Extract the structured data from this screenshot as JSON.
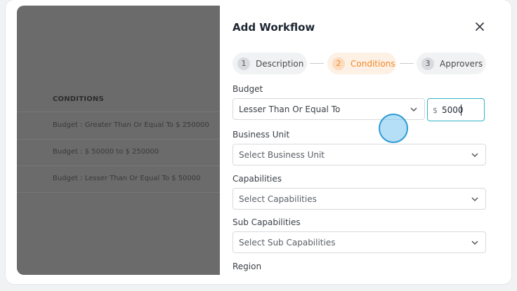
{
  "background_table": {
    "header": "CONDITIONS",
    "rows": [
      "Budget : Greater Than Or Equal To $ 250000",
      "Budget : $ 50000 to $ 250000",
      "Budget : Lesser Than Or Equal To $ 50000"
    ]
  },
  "modal": {
    "title": "Add Workflow",
    "close_icon": "close-icon",
    "steps": [
      {
        "number": "1",
        "label": "Description",
        "state": "completed"
      },
      {
        "number": "2",
        "label": "Conditions",
        "state": "active"
      },
      {
        "number": "3",
        "label": "Approvers",
        "state": "pending"
      }
    ],
    "fields": {
      "budget": {
        "label": "Budget",
        "operator_value": "Lesser Than Or Equal To",
        "currency": "$",
        "amount": "5000"
      },
      "business_unit": {
        "label": "Business Unit",
        "placeholder": "Select Business Unit"
      },
      "capabilities": {
        "label": "Capabilities",
        "placeholder": "Select Capabilities"
      },
      "sub_capabilities": {
        "label": "Sub Capabilities",
        "placeholder": "Select Sub Capabilities"
      },
      "region": {
        "label": "Region"
      }
    }
  },
  "colors": {
    "accent_orange": "#f08a2c",
    "focus_teal": "#33b3c3",
    "overlay_gray": "#6b6b6b"
  }
}
